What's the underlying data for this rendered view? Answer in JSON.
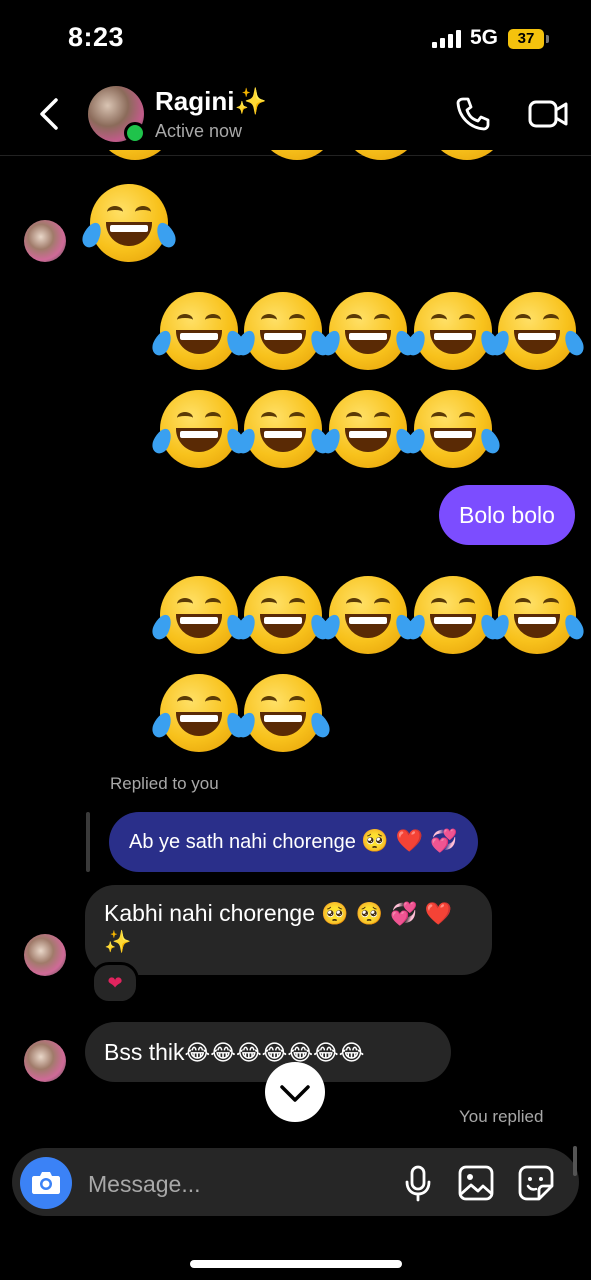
{
  "status_bar": {
    "time": "8:23",
    "network": "5G",
    "battery": "37"
  },
  "header": {
    "contact_name": "Ragini✨",
    "contact_status": "Active now",
    "icons": [
      "back-icon",
      "phone-icon",
      "video-icon"
    ]
  },
  "messages": {
    "sent_bubble_1": "Bolo bolo",
    "replied_label": "Replied to you",
    "quoted_text": "Ab ye sath nahi chorenge",
    "quoted_emojis": "🥺 ❤️ 💞",
    "received_1_text": "Kabhi nahi chorenge",
    "received_1_emojis": "🥺 🥺 💞 ❤️",
    "received_1_emoji_line2": "✨",
    "reaction": "❤",
    "received_2_text": "Bss thik",
    "received_2_emojis": "😂😂😂😂😂😂😂",
    "you_replied_label": "You replied"
  },
  "composer": {
    "placeholder": "Message..."
  },
  "colors": {
    "sent_bubble": "#7c4dff",
    "quoted_bubble": "#2a2f8a",
    "received_bubble": "#262626",
    "camera_button": "#3b82f6",
    "online": "#1fc34b"
  }
}
